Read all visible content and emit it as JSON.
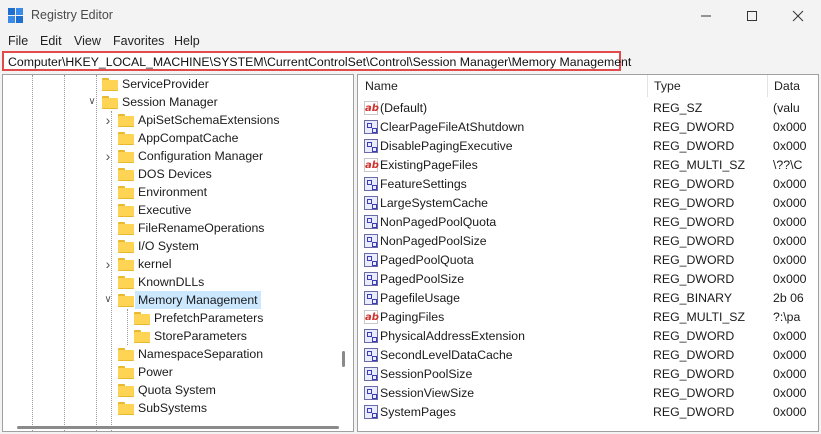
{
  "window": {
    "title": "Registry Editor"
  },
  "menu": [
    "File",
    "Edit",
    "View",
    "Favorites",
    "Help"
  ],
  "address": "Computer\\HKEY_LOCAL_MACHINE\\SYSTEM\\CurrentControlSet\\Control\\Session Manager\\Memory Management",
  "tree": [
    {
      "label": "ServiceProvider",
      "level": 0,
      "chevron": ""
    },
    {
      "label": "Session Manager",
      "level": 0,
      "chevron": "open"
    },
    {
      "label": "ApiSetSchemaExtensions",
      "level": 1,
      "chevron": "closed"
    },
    {
      "label": "AppCompatCache",
      "level": 1,
      "chevron": ""
    },
    {
      "label": "Configuration Manager",
      "level": 1,
      "chevron": "closed"
    },
    {
      "label": "DOS Devices",
      "level": 1,
      "chevron": ""
    },
    {
      "label": "Environment",
      "level": 1,
      "chevron": ""
    },
    {
      "label": "Executive",
      "level": 1,
      "chevron": ""
    },
    {
      "label": "FileRenameOperations",
      "level": 1,
      "chevron": ""
    },
    {
      "label": "I/O System",
      "level": 1,
      "chevron": ""
    },
    {
      "label": "kernel",
      "level": 1,
      "chevron": "closed"
    },
    {
      "label": "KnownDLLs",
      "level": 1,
      "chevron": ""
    },
    {
      "label": "Memory Management",
      "level": 1,
      "chevron": "open",
      "selected": true
    },
    {
      "label": "PrefetchParameters",
      "level": 2,
      "chevron": ""
    },
    {
      "label": "StoreParameters",
      "level": 2,
      "chevron": ""
    },
    {
      "label": "NamespaceSeparation",
      "level": 1,
      "chevron": ""
    },
    {
      "label": "Power",
      "level": 1,
      "chevron": ""
    },
    {
      "label": "Quota System",
      "level": 1,
      "chevron": ""
    },
    {
      "label": "SubSystems",
      "level": 1,
      "chevron": ""
    }
  ],
  "columns": {
    "name": "Name",
    "type": "Type",
    "data": "Data"
  },
  "values": [
    {
      "name": "(Default)",
      "type": "REG_SZ",
      "data": "(valu",
      "icon": "string"
    },
    {
      "name": "ClearPageFileAtShutdown",
      "type": "REG_DWORD",
      "data": "0x000",
      "icon": "binary"
    },
    {
      "name": "DisablePagingExecutive",
      "type": "REG_DWORD",
      "data": "0x000",
      "icon": "binary"
    },
    {
      "name": "ExistingPageFiles",
      "type": "REG_MULTI_SZ",
      "data": "\\??\\C",
      "icon": "string"
    },
    {
      "name": "FeatureSettings",
      "type": "REG_DWORD",
      "data": "0x000",
      "icon": "binary"
    },
    {
      "name": "LargeSystemCache",
      "type": "REG_DWORD",
      "data": "0x000",
      "icon": "binary"
    },
    {
      "name": "NonPagedPoolQuota",
      "type": "REG_DWORD",
      "data": "0x000",
      "icon": "binary"
    },
    {
      "name": "NonPagedPoolSize",
      "type": "REG_DWORD",
      "data": "0x000",
      "icon": "binary"
    },
    {
      "name": "PagedPoolQuota",
      "type": "REG_DWORD",
      "data": "0x000",
      "icon": "binary"
    },
    {
      "name": "PagedPoolSize",
      "type": "REG_DWORD",
      "data": "0x000",
      "icon": "binary"
    },
    {
      "name": "PagefileUsage",
      "type": "REG_BINARY",
      "data": "2b 06",
      "icon": "binary"
    },
    {
      "name": "PagingFiles",
      "type": "REG_MULTI_SZ",
      "data": "?:\\pa",
      "icon": "string"
    },
    {
      "name": "PhysicalAddressExtension",
      "type": "REG_DWORD",
      "data": "0x000",
      "icon": "binary"
    },
    {
      "name": "SecondLevelDataCache",
      "type": "REG_DWORD",
      "data": "0x000",
      "icon": "binary"
    },
    {
      "name": "SessionPoolSize",
      "type": "REG_DWORD",
      "data": "0x000",
      "icon": "binary"
    },
    {
      "name": "SessionViewSize",
      "type": "REG_DWORD",
      "data": "0x000",
      "icon": "binary"
    },
    {
      "name": "SystemPages",
      "type": "REG_DWORD",
      "data": "0x000",
      "icon": "binary"
    }
  ],
  "colors": {
    "highlight": "#cce8ff",
    "address_outline": "#e14b4b",
    "folder": "#ffd353"
  }
}
